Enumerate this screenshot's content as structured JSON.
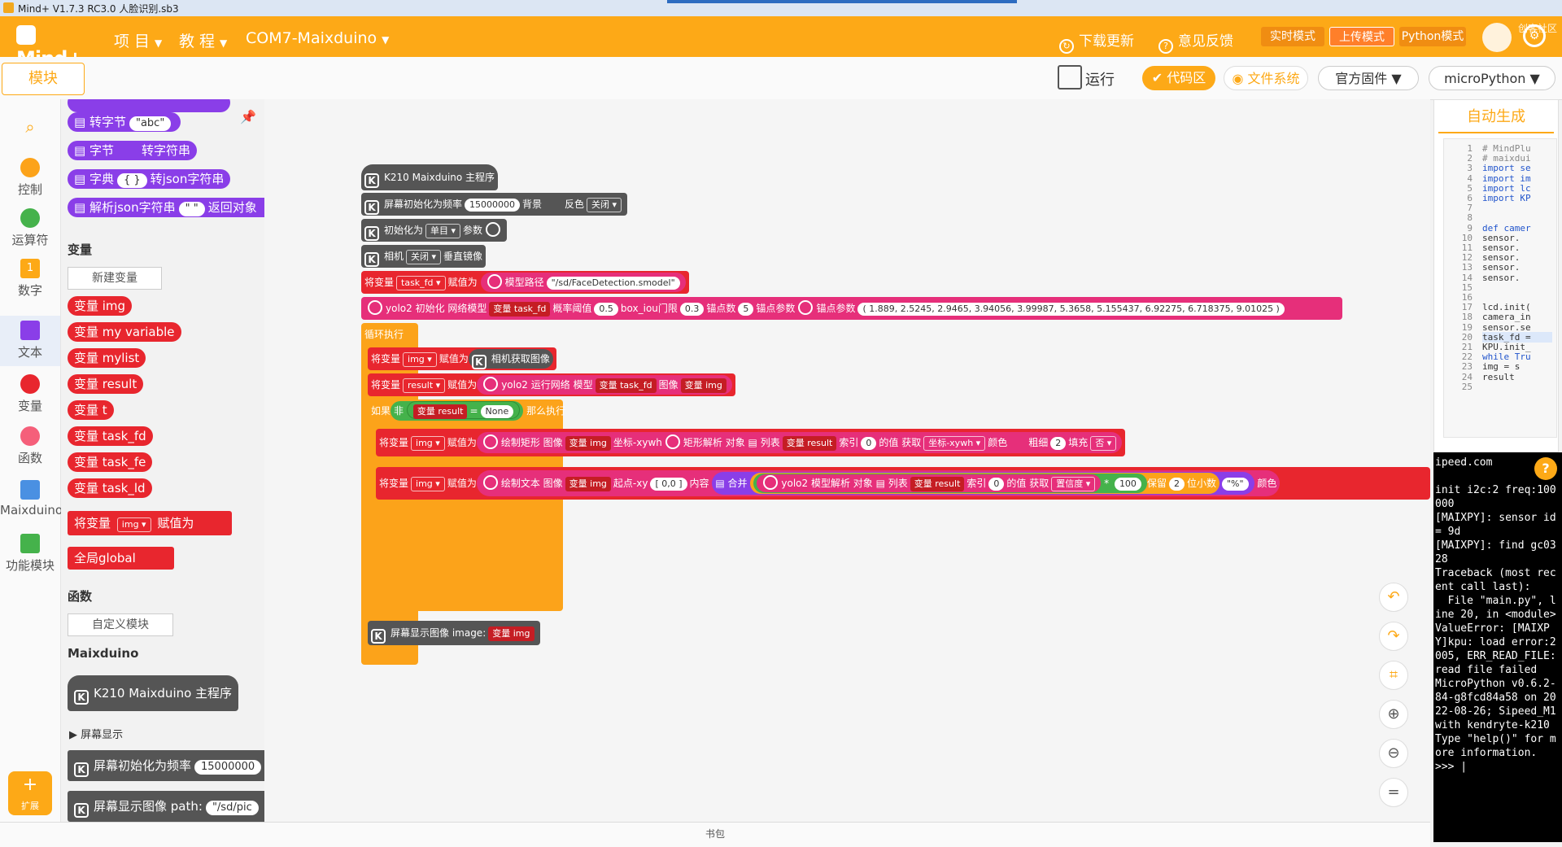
{
  "window_title": "Mind+ V1.7.3 RC3.0   人脸识别.sb3",
  "header": {
    "logo": "Mind+",
    "menus": [
      "项 目",
      "教 程",
      "COM7-Maixduino"
    ],
    "download_update": "下载更新",
    "feedback": "意见反馈",
    "modes": [
      "实时模式",
      "上传模式",
      "Python模式"
    ],
    "community": "创客社区"
  },
  "toolbar": {
    "modules_tab": "模块",
    "run": "运行",
    "code_area": "代码区",
    "file_system": "文件系统",
    "firmware": "官方固件",
    "language": "microPython"
  },
  "categories": [
    "控制",
    "运算符",
    "数字",
    "文本",
    "变量",
    "函数",
    "Maixduino",
    "功能模块"
  ],
  "palette": {
    "text_blocks": [
      "转字节",
      "\"abc\"",
      "字节",
      "转字符串",
      "字典",
      "{ }",
      "转json字符串",
      "解析json字符串",
      "\" \"",
      "返回对象"
    ],
    "variables_heading": "变量",
    "new_variable": "新建变量",
    "vars": [
      "变量 img",
      "变量 my variable",
      "变量 mylist",
      "变量 result",
      "变量 t",
      "变量 task_fd",
      "变量 task_fe",
      "变量 task_ld"
    ],
    "set_var": "将变量",
    "set_var_name": "img",
    "set_var_assign": "赋值为",
    "global": "全局global",
    "functions_heading": "函数",
    "custom_module": "自定义模块",
    "maix_heading": "Maixduino",
    "k210_main": "K210 Maixduino 主程序",
    "screen_display": "屏幕显示",
    "screen_init": "屏幕初始化为频率",
    "screen_init_val": "15000000",
    "screen_show_path": "屏幕显示图像 path:",
    "screen_show_path_val": "\"/sd/pic"
  },
  "canvas": {
    "main": "K210 Maixduino 主程序",
    "screen_init": "屏幕初始化为频率",
    "screen_freq": "15000000",
    "bg": "背景",
    "invert": "反色",
    "invert_val": "关闭",
    "init_as": "初始化为",
    "init_mode": "单目",
    "params": "参数",
    "camera": "相机",
    "camera_val": "关闭",
    "vflip": "垂直镜像",
    "set_var": "将变量",
    "task_fd": "task_fd",
    "assign": "赋值为",
    "model_path_label": "模型路径",
    "model_path": "\"/sd/FaceDetection.smodel\"",
    "yolo_init": "yolo2 初始化 网络模型",
    "var_task_fd": "变量 task_fd",
    "prob_thresh": "概率阈值",
    "prob_val": "0.5",
    "iou": "box_iou门限",
    "iou_val": "0.3",
    "anchor_num": "锚点数",
    "anchor_num_val": "5",
    "anchor_param": "锚点参数",
    "anchor_param2": "锚点参数",
    "anchors": "( 1.889, 2.5245, 2.9465, 3.94056, 3.99987, 5.3658, 5.155437, 6.92275, 6.718375, 9.01025 )",
    "loop": "循环执行",
    "img": "img",
    "camera_get": "相机获取图像",
    "result": "result",
    "yolo_run": "yolo2 运行网络 模型",
    "image": "图像",
    "var_img": "变量 img",
    "if": "如果",
    "not": "非",
    "var_result": "变量 result",
    "eq": "=",
    "none": "None",
    "then": "那么执行",
    "draw_rect": "绘制矩形 图像",
    "coord_xywh": "坐标-xywh",
    "rect_parse": "矩形解析 对象",
    "list": "列表",
    "index": "索引",
    "idx_val": "0",
    "of_val": "的值",
    "get": "获取",
    "get_val": "坐标-xywh",
    "color": "颜色",
    "thick": "粗细",
    "thick_val": "2",
    "fill": "填充",
    "fill_val": "否",
    "draw_text": "绘制文本 图像",
    "start_xy": "起点-xy",
    "start_xy_val": "[ 0,0 ]",
    "content": "内容",
    "merge": "合并",
    "yolo_parse": "yolo2 模型解析 对象",
    "confidence": "置信度",
    "mult": "100",
    "keep": "保留",
    "keep_val": "2",
    "decimals": "位小数",
    "percent": "\"%\"",
    "color2": "颜色",
    "screen_show": "屏幕显示图像 image:"
  },
  "code": {
    "header": "自动生成",
    "line_numbers": [
      "1",
      "2",
      "3",
      "4",
      "5",
      "6",
      "7",
      "8",
      "9",
      "10",
      "11",
      "12",
      "13",
      "14",
      "15",
      "16",
      "17",
      "18",
      "19",
      "20",
      "21",
      "22",
      "23",
      "24",
      "25"
    ],
    "lines": [
      "# MindPlu",
      "# maixdui",
      "import se",
      "import im",
      "import lc",
      "import KP",
      "",
      "",
      "def camer",
      "  sensor.",
      "  sensor.",
      "  sensor.",
      "  sensor.",
      "  sensor.",
      "",
      "",
      "lcd.init(",
      "camera_in",
      "sensor.se",
      "task_fd =",
      "KPU.init_",
      "while Tru",
      "  img = s",
      "  result",
      ""
    ]
  },
  "terminal": "ipeed.com\n\ninit i2c:2 freq:100000\n[MAIXPY]: sensor id = 9d\n[MAIXPY]: find gc0328\nTraceback (most recent call last):\n  File \"main.py\", line 20, in <module>\nValueError: [MAIXPY]kpu: load error:2005, ERR_READ_FILE: read file failed\nMicroPython v0.6.2-84-g8fcd84a58 on 2022-08-26; Sipeed_M1 with kendryte-k210\nType \"help()\" for more information.\n>>> |",
  "bottom": "书包",
  "extend": "扩展"
}
